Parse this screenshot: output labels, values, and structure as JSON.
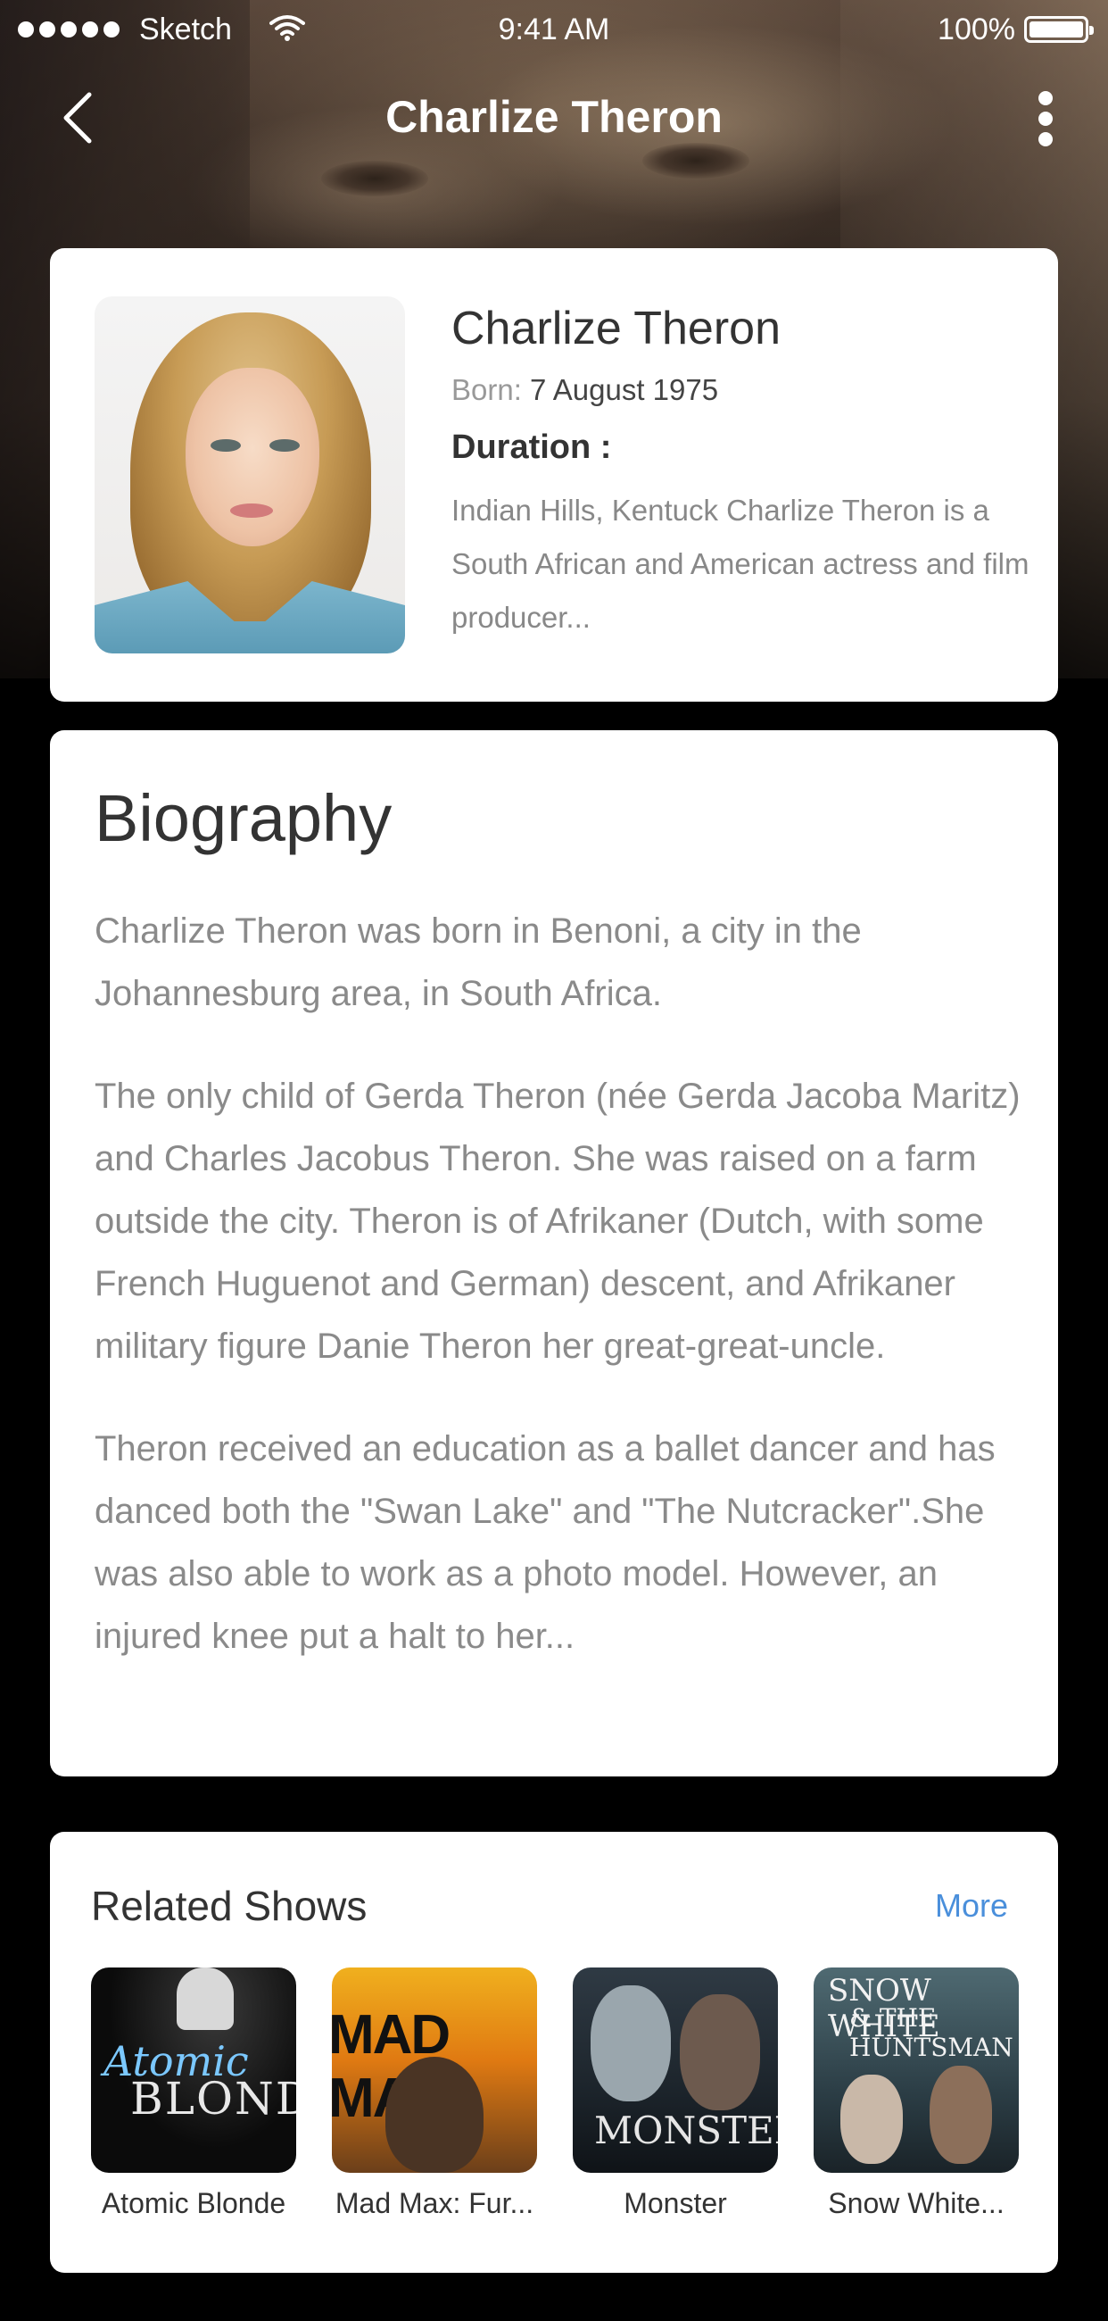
{
  "status_bar": {
    "carrier": "Sketch",
    "time": "9:41 AM",
    "battery": "100%"
  },
  "nav": {
    "title": "Charlize Theron"
  },
  "profile": {
    "name": "Charlize Theron",
    "born_label": "Born:",
    "born_value": "7 August 1975",
    "duration_label": "Duration :",
    "description": "Indian Hills, Kentuck Charlize Theron is a South African and American actress and film producer..."
  },
  "biography": {
    "title": "Biography",
    "paragraphs": [
      "Charlize Theron was born in Benoni, a city in the Johannesburg area, in South Africa.",
      "The only child of Gerda Theron (née Gerda Jacoba Maritz) and Charles Jacobus Theron. She was raised on a farm outside the city. Theron is of Afrikaner (Dutch, with some French Huguenot and German) descent, and Afrikaner military figure Danie Theron her great-great-uncle.",
      "Theron received an education as a ballet dancer and has danced both the \"Swan Lake\" and \"The Nutcracker\".She was also able to work as a photo model. However, an injured knee put a halt to her..."
    ]
  },
  "related_shows": {
    "title": "Related Shows",
    "more_label": "More",
    "items": [
      {
        "label": "Atomic Blonde",
        "poster_text": [
          "Atomic",
          "BLONDE"
        ]
      },
      {
        "label": "Mad Max: Fur...",
        "poster_text": [
          "MAD MAX"
        ]
      },
      {
        "label": "Monster",
        "poster_text": [
          "MONSTER"
        ]
      },
      {
        "label": "Snow White...",
        "poster_text": [
          "SNOW WHITE",
          "& THE HUNTSMAN"
        ]
      }
    ]
  },
  "colors": {
    "accent_link": "#4a8fdb",
    "card_bg": "#ffffff",
    "page_bg": "#000000"
  }
}
